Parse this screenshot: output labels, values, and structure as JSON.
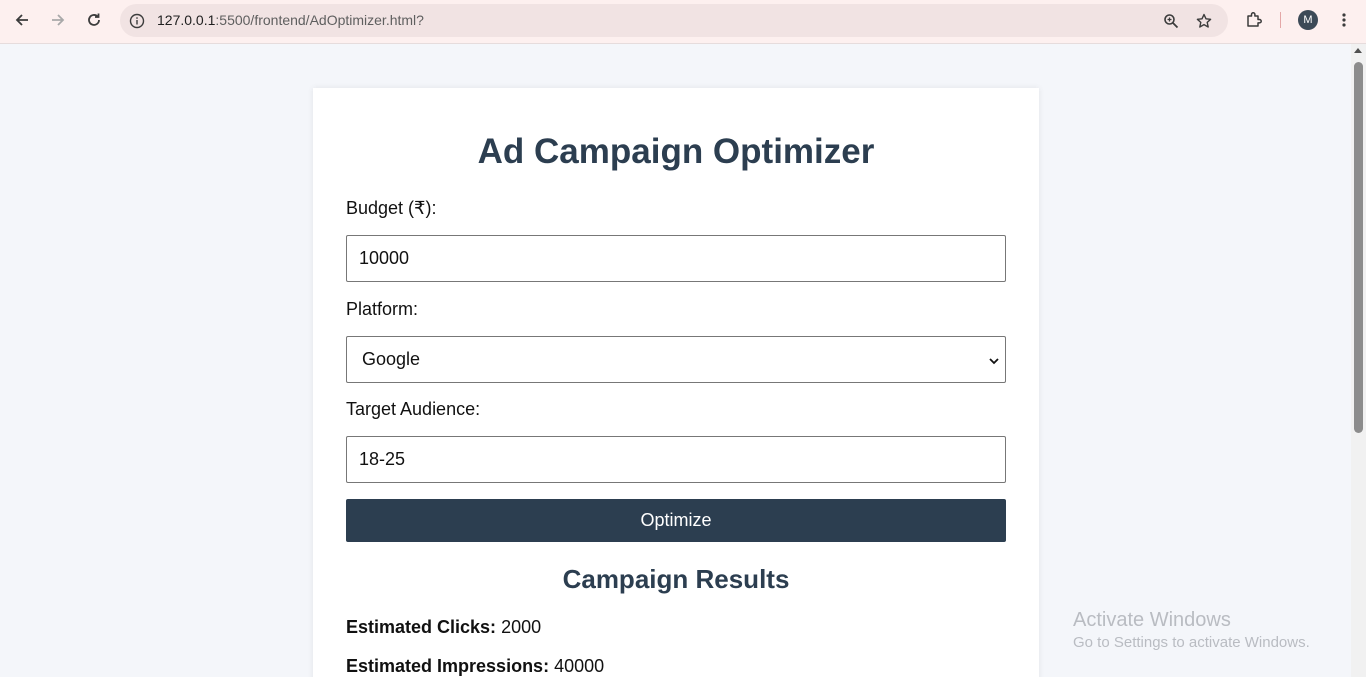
{
  "browser": {
    "url_host": "127.0.0.1",
    "url_path": ":5500/frontend/AdOptimizer.html?",
    "profile_initial": "M",
    "icons": [
      "back-arrow-icon",
      "forward-arrow-icon",
      "reload-icon",
      "site-info-icon",
      "zoom-icon",
      "bookmark-star-icon",
      "extensions-icon",
      "more-menu-icon"
    ]
  },
  "page": {
    "title": "Ad Campaign Optimizer",
    "budget_label": "Budget (₹):",
    "budget_value": "10000",
    "platform_label": "Platform:",
    "platform_value": "Google",
    "audience_label": "Target Audience:",
    "audience_value": "18-25",
    "optimize_label": "Optimize",
    "results_title": "Campaign Results",
    "results": [
      {
        "label": "Estimated Clicks:",
        "value": "2000"
      },
      {
        "label": "Estimated Impressions:",
        "value": "40000"
      }
    ]
  },
  "watermark": {
    "line1": "Activate Windows",
    "line2": "Go to Settings to activate Windows."
  },
  "colors": {
    "accent": "#2c3e50",
    "page_bg": "#f4f6fa",
    "chrome_bg": "#fdf0ef"
  }
}
